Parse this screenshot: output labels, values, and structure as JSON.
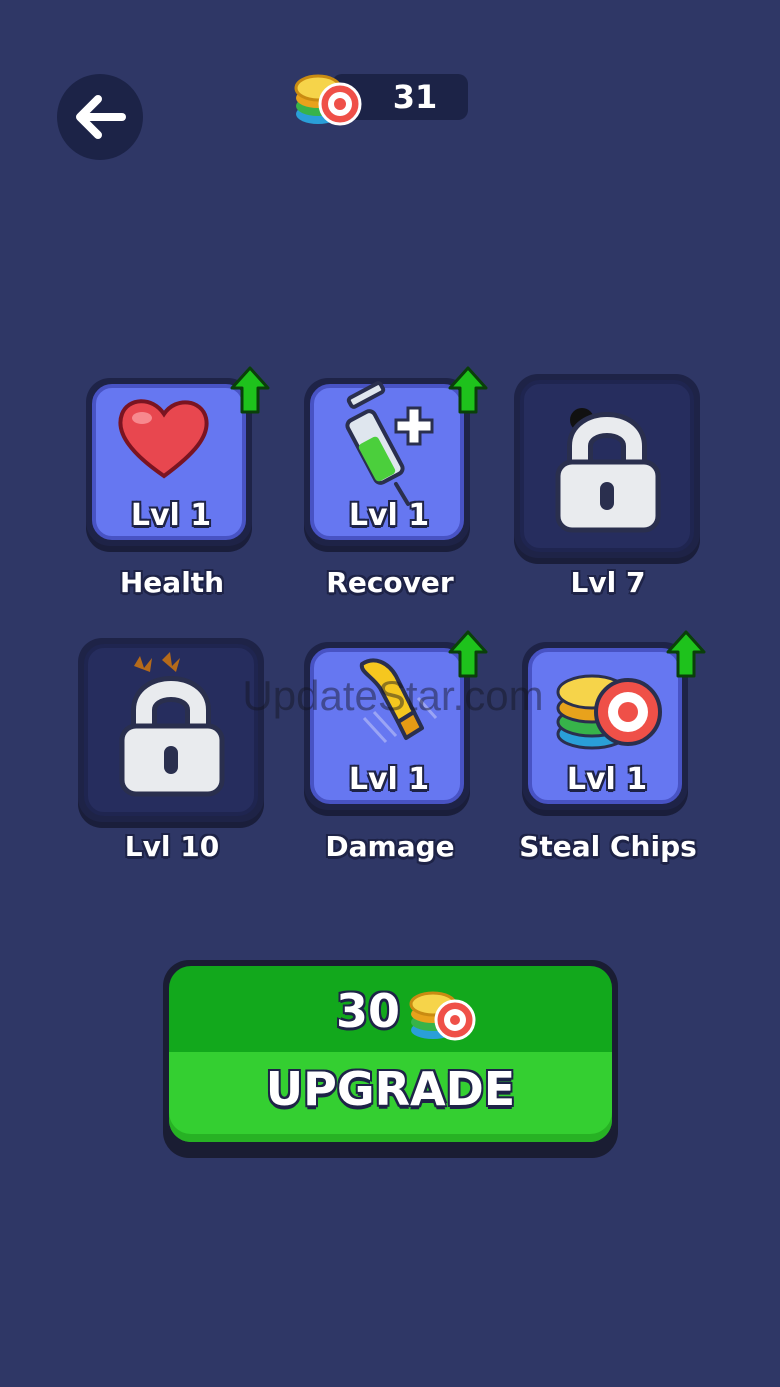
{
  "header": {
    "back_icon": "arrow-left-icon",
    "chip_count": "31",
    "chip_icon": "poker-chips-icon"
  },
  "upgrades": [
    {
      "label": "Health",
      "level": "Lvl 1",
      "icon": "heart-icon",
      "upgradable": true
    },
    {
      "label": "Recover",
      "level": "Lvl 1",
      "icon": "syringe-icon",
      "upgradable": true
    },
    {
      "label": "Lvl 7",
      "level": "",
      "icon": "lock-icon",
      "upgradable": false
    },
    {
      "label": "Lvl 10",
      "level": "",
      "icon": "lock-icon",
      "upgradable": false
    },
    {
      "label": "Damage",
      "level": "Lvl 1",
      "icon": "bullet-icon",
      "upgradable": true
    },
    {
      "label": "Steal Chips",
      "level": "Lvl 1",
      "icon": "poker-chips-icon",
      "upgradable": true
    }
  ],
  "upgrade_button": {
    "cost": "30",
    "label": "UPGRADE",
    "cost_icon": "poker-chips-icon"
  },
  "watermark": "UpdateStar.com",
  "colors": {
    "background": "#2f3766",
    "card_active": "#6677f1",
    "card_locked": "#262d5e",
    "upgrade_green": "#34cf31",
    "arrow_green": "#1ec21c"
  }
}
